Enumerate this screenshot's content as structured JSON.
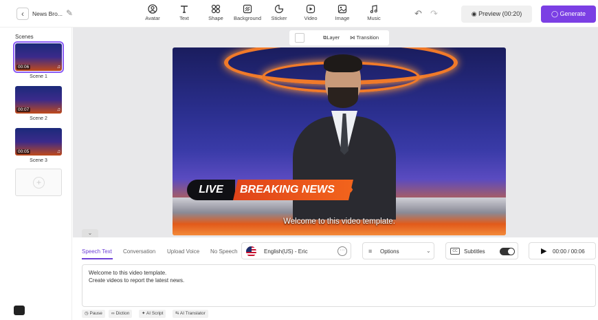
{
  "header": {
    "project_title": "News Bro...",
    "tools": [
      {
        "label": "Avatar",
        "icon": "avatar-icon"
      },
      {
        "label": "Text",
        "icon": "text-icon"
      },
      {
        "label": "Shape",
        "icon": "shape-icon"
      },
      {
        "label": "Background",
        "icon": "background-icon"
      },
      {
        "label": "Sticker",
        "icon": "sticker-icon"
      },
      {
        "label": "Video",
        "icon": "video-icon"
      },
      {
        "label": "Image",
        "icon": "image-icon"
      },
      {
        "label": "Music",
        "icon": "music-icon"
      }
    ],
    "preview_label": "Preview (00:20)",
    "generate_label": "Generate",
    "accent_color": "#7b3fe4"
  },
  "scenes": {
    "title": "Scenes",
    "items": [
      {
        "name": "Scene 1",
        "duration": "00:06",
        "active": true
      },
      {
        "name": "Scene 2",
        "duration": "00:07",
        "active": false
      },
      {
        "name": "Scene 3",
        "duration": "00:05",
        "active": false
      }
    ]
  },
  "canvas": {
    "layer_label": "Layer",
    "transition_label": "Transition",
    "live_text": "LIVE",
    "breaking_text": "BREAKING NEWS",
    "caption": "Welcome to this video template."
  },
  "editor": {
    "tabs": [
      "Speech Text",
      "Conversation",
      "Upload Voice",
      "No Speech"
    ],
    "active_tab": "Speech Text",
    "voice": "English(US) - Eric",
    "options_label": "Options",
    "subtitles_label": "Subtitles",
    "subtitles_on": true,
    "time": "00:00 / 00:06",
    "speech_lines": [
      "Welcome to this video template.",
      "Create videos to report the latest news."
    ],
    "chips": [
      "Pause",
      "Diction",
      "AI Script",
      "AI Translator"
    ]
  }
}
